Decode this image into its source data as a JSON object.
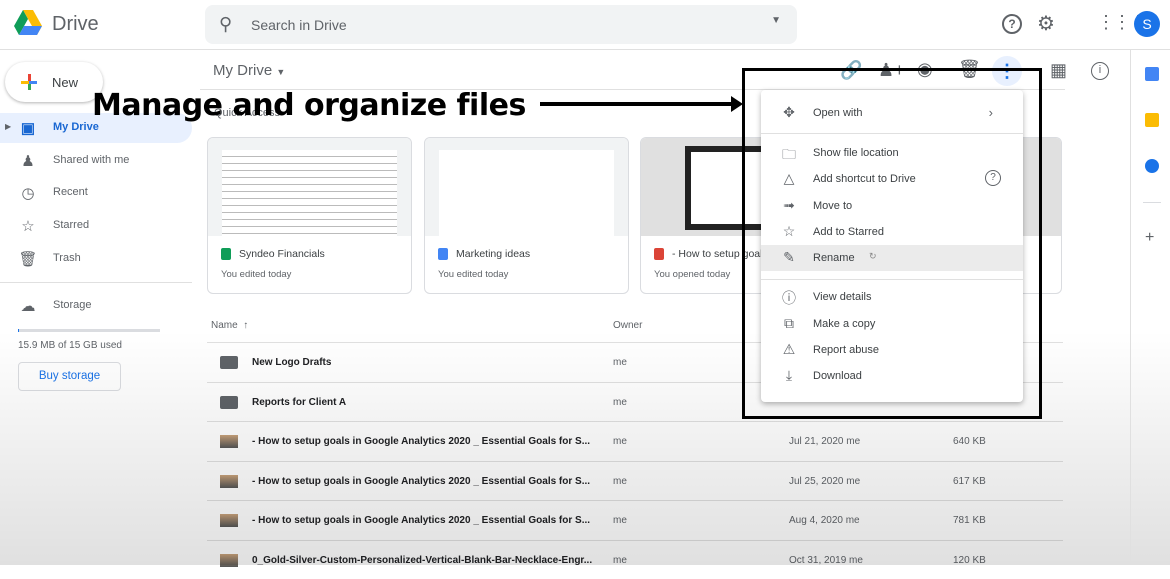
{
  "app": {
    "title": "Drive"
  },
  "search": {
    "placeholder": "Search in Drive"
  },
  "header": {
    "avatar_letter": "S"
  },
  "sidebar": {
    "new_label": "New",
    "items": [
      {
        "label": "My Drive",
        "icon": "my-drive-icon"
      },
      {
        "label": "Shared with me",
        "icon": "people-icon"
      },
      {
        "label": "Recent",
        "icon": "clock-icon"
      },
      {
        "label": "Starred",
        "icon": "star-icon"
      },
      {
        "label": "Trash",
        "icon": "trash-icon"
      }
    ],
    "storage_label": "Storage",
    "storage_used": "15.9 MB of 15 GB used",
    "storage_fraction": 0.001,
    "buy_storage": "Buy storage"
  },
  "main": {
    "breadcrumb": "My Drive",
    "quick_access_label": "Quick Access",
    "cards": [
      {
        "name": "Syndeo Financials",
        "sub": "You edited today",
        "type": "sheets",
        "color": "#0f9d58"
      },
      {
        "name": "Marketing ideas",
        "sub": "You edited today",
        "type": "docs",
        "color": "#4285f4"
      },
      {
        "name": "- How to setup goals in Google...",
        "sub": "You opened today",
        "type": "image",
        "color": "#db4437"
      }
    ],
    "columns": {
      "name": "Name",
      "owner": "Owner"
    },
    "rows": [
      {
        "name": "New Logo Drafts",
        "owner": "me",
        "modified": "",
        "size": "",
        "type": "folder"
      },
      {
        "name": "Reports for Client A",
        "owner": "me",
        "modified": "",
        "size": "",
        "type": "folder"
      },
      {
        "name": "- How to setup goals in Google Analytics 2020 _ Essential Goals for S...",
        "owner": "me",
        "modified": "Jul 21, 2020 me",
        "size": "640 KB",
        "type": "image"
      },
      {
        "name": "- How to setup goals in Google Analytics 2020 _ Essential Goals for S...",
        "owner": "me",
        "modified": "Jul 25, 2020 me",
        "size": "617 KB",
        "type": "image"
      },
      {
        "name": "- How to setup goals in Google Analytics 2020 _ Essential Goals for S...",
        "owner": "me",
        "modified": "Aug 4, 2020 me",
        "size": "781 KB",
        "type": "image"
      },
      {
        "name": "0_Gold-Silver-Custom-Personalized-Vertical-Blank-Bar-Necklace-Engr...",
        "owner": "me",
        "modified": "Oct 31, 2019 me",
        "size": "120 KB",
        "type": "image"
      }
    ]
  },
  "context_menu": {
    "items": [
      {
        "label": "Open with",
        "icon": "move-arrows-icon"
      },
      {
        "label": "Show file location",
        "icon": "folder-icon"
      },
      {
        "label": "Add shortcut to Drive",
        "icon": "add-shortcut-icon"
      },
      {
        "label": "Move to",
        "icon": "move-to-folder-icon"
      },
      {
        "label": "Add to Starred",
        "icon": "star-icon"
      },
      {
        "label": "Rename",
        "icon": "pencil-icon"
      },
      {
        "label": "View details",
        "icon": "info-icon"
      },
      {
        "label": "Make a copy",
        "icon": "copy-icon"
      },
      {
        "label": "Report abuse",
        "icon": "alert-icon"
      },
      {
        "label": "Download",
        "icon": "download-icon"
      }
    ],
    "highlighted": "Rename"
  },
  "annotation": {
    "caption": "Manage and organize files"
  },
  "colors": {
    "accent": "#1967d2",
    "active_bg": "#e8f0fe"
  }
}
